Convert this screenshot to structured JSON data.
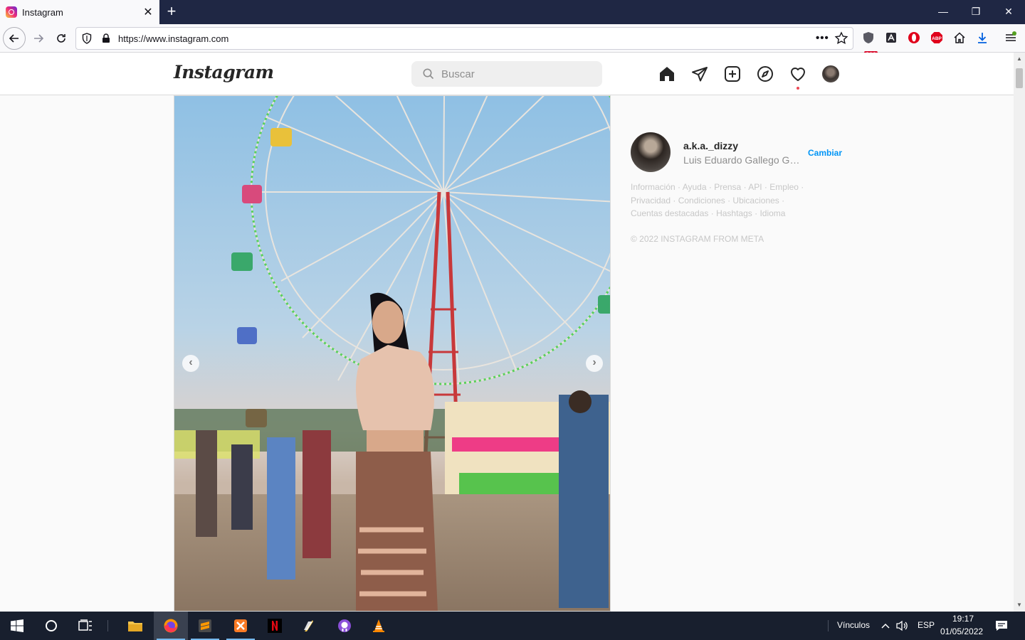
{
  "browser": {
    "tab_title": "Instagram",
    "tab_close": "✕",
    "new_tab": "+",
    "url": "https://www.instagram.com",
    "url_more": "•••",
    "extension_badge": "210",
    "window_controls": {
      "minimize": "—",
      "restore": "❐",
      "close": "✕"
    }
  },
  "instagram": {
    "logo": "Instagram",
    "search_placeholder": "Buscar",
    "nav_icons": [
      "home-icon",
      "direct-icon",
      "new-post-icon",
      "explore-icon",
      "activity-icon",
      "profile-avatar"
    ],
    "carousel": {
      "prev": "‹",
      "next": "›"
    },
    "sidebar": {
      "username": "a.k.a._dizzy",
      "full_name": "Luis Eduardo Gallego Gar...",
      "switch_label": "Cambiar",
      "footer_links": [
        "Información",
        "Ayuda",
        "Prensa",
        "API",
        "Empleo",
        "Privacidad",
        "Condiciones",
        "Ubicaciones",
        "Cuentas destacadas",
        "Hashtags",
        "Idioma"
      ],
      "copyright": "© 2022 INSTAGRAM FROM META"
    }
  },
  "taskbar": {
    "links_label": "Vínculos",
    "language": "ESP",
    "time": "19:17",
    "date": "01/05/2022"
  },
  "colors": {
    "accent": "#0095f6",
    "notification": "#ed4956",
    "tabbar": "#1f2744",
    "taskbar": "#181f2e"
  }
}
